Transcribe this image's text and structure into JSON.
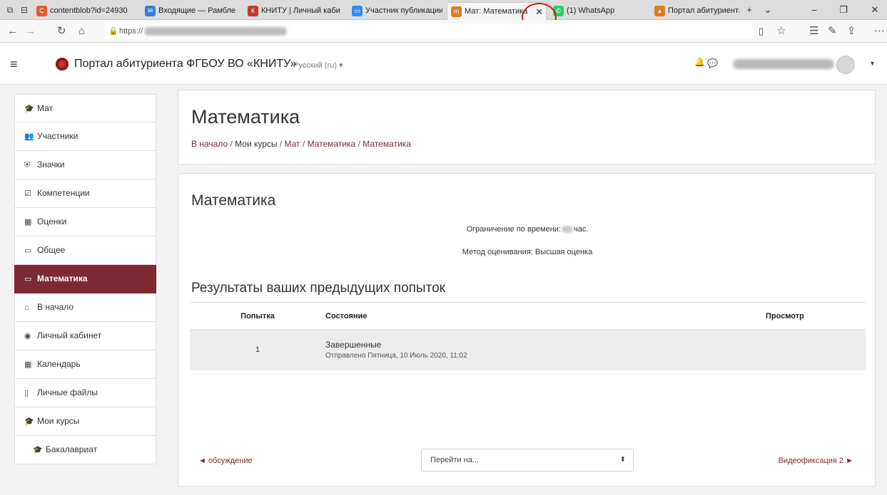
{
  "browser": {
    "tabs": [
      {
        "label": "contentblob?id=24930",
        "favicon": "C",
        "color": "#e55b2c"
      },
      {
        "label": "Входящие — Рамблер",
        "favicon": "✉",
        "color": "#3b7dd8"
      },
      {
        "label": "КНИТУ | Личный каби",
        "favicon": "К",
        "color": "#c0392b"
      },
      {
        "label": "Участник публикации",
        "favicon": "▭",
        "color": "#2d8cf0"
      },
      {
        "label": "Мат: Математика",
        "favicon": "m",
        "color": "#e07b1f"
      },
      {
        "label": "(1) WhatsApp",
        "favicon": "✆",
        "color": "#25d366"
      },
      {
        "label": "Портал абитуриента Ф",
        "favicon": "▴",
        "color": "#e07b1f"
      }
    ],
    "tab_close_glyph": "✕",
    "new_tab_glyph": "+",
    "dropdown_glyph": "⌄",
    "url": "https://",
    "icons": [
      "back-icon",
      "forward-icon",
      "refresh-icon",
      "home-icon",
      "lock-icon",
      "reading-view-icon",
      "favorite-icon",
      "favorites-hub-icon",
      "pen-icon",
      "share-icon",
      "more-icon"
    ]
  },
  "site": {
    "name": "Портал абитуриента ФГБОУ ВО «КНИТУ»",
    "language": "Русский (ru) ▾",
    "brand_color": "#7e2a32"
  },
  "sidebar": {
    "items": [
      {
        "label": "Мат",
        "icon": "graduation-cap-icon",
        "glyph": "🎓"
      },
      {
        "label": "Участники",
        "icon": "users-icon",
        "glyph": "👥"
      },
      {
        "label": "Значки",
        "icon": "shield-icon",
        "glyph": "⛨"
      },
      {
        "label": "Компетенции",
        "icon": "checkbox-icon",
        "glyph": "☑"
      },
      {
        "label": "Оценки",
        "icon": "table-icon",
        "glyph": "▦"
      },
      {
        "label": "Общее",
        "icon": "folder-icon",
        "glyph": "▭"
      },
      {
        "label": "Математика",
        "icon": "folder-icon",
        "glyph": "▭"
      },
      {
        "label": "В начало",
        "icon": "home-icon",
        "glyph": "⌂"
      },
      {
        "label": "Личный кабинет",
        "icon": "dashboard-icon",
        "glyph": "◉"
      },
      {
        "label": "Календарь",
        "icon": "calendar-icon",
        "glyph": "▦"
      },
      {
        "label": "Личные файлы",
        "icon": "file-icon",
        "glyph": "▯"
      },
      {
        "label": "Мои курсы",
        "icon": "graduation-cap-icon",
        "glyph": "🎓"
      },
      {
        "label": "Бакалавриат",
        "icon": "graduation-cap-icon",
        "glyph": "🎓"
      }
    ]
  },
  "header": {
    "title": "Математика",
    "breadcrumb": [
      "В начало",
      "Мои курсы",
      "Мат",
      "Математика",
      "Математика"
    ]
  },
  "quiz": {
    "title": "Математика",
    "time_limit_prefix": "Ограничение по времени:",
    "time_limit_suffix": "час.",
    "grading_method": "Метод оценивания: Высшая оценка",
    "results_heading": "Результаты ваших предыдущих попыток",
    "table": {
      "columns": [
        "Попытка",
        "Состояние",
        "Просмотр"
      ],
      "rows": [
        {
          "attempt": "1",
          "state": "Завершенные",
          "submitted": "Отправлено Пятница, 10 Июль 2020, 11:02",
          "review": ""
        }
      ]
    },
    "prev_link": "◄ обсуждение",
    "jump_placeholder": "Перейти на...",
    "next_link": "Видеофиксация 2 ►"
  }
}
